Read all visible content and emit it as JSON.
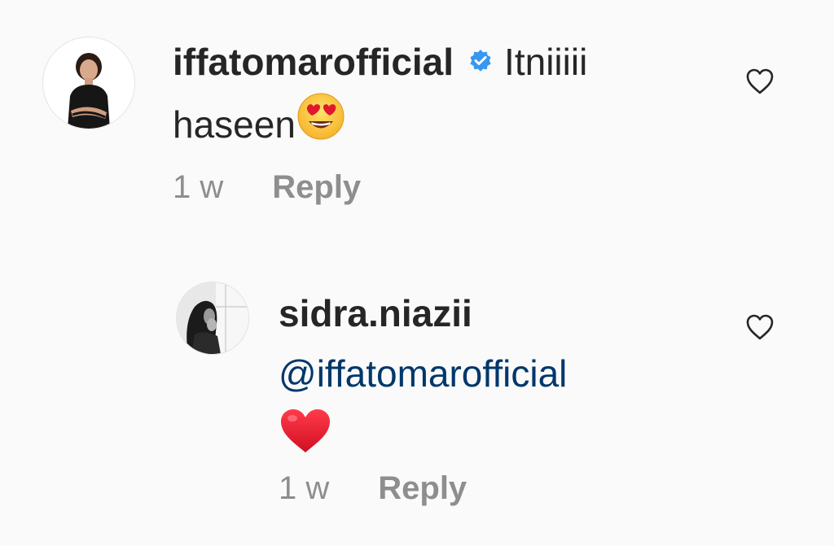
{
  "comments": [
    {
      "username": "iffatomarofficial",
      "verified": true,
      "text_line1": "Itniiiii",
      "text_line2": "haseen",
      "emoji": "heart-eyes-emoji",
      "time": "1 w",
      "reply_label": "Reply"
    },
    {
      "username": "sidra.niazii",
      "verified": false,
      "mention": "@iffatomarofficial",
      "emoji": "red-heart-emoji",
      "time": "1 w",
      "reply_label": "Reply"
    }
  ],
  "colors": {
    "background": "#fafafa",
    "text": "#262626",
    "meta": "#8e8e8e",
    "mention": "#00376b",
    "verified": "#3897f0",
    "heart": "#e0182c"
  },
  "icons": {
    "like": "heart-outline-icon",
    "verified": "verified-badge-icon"
  }
}
